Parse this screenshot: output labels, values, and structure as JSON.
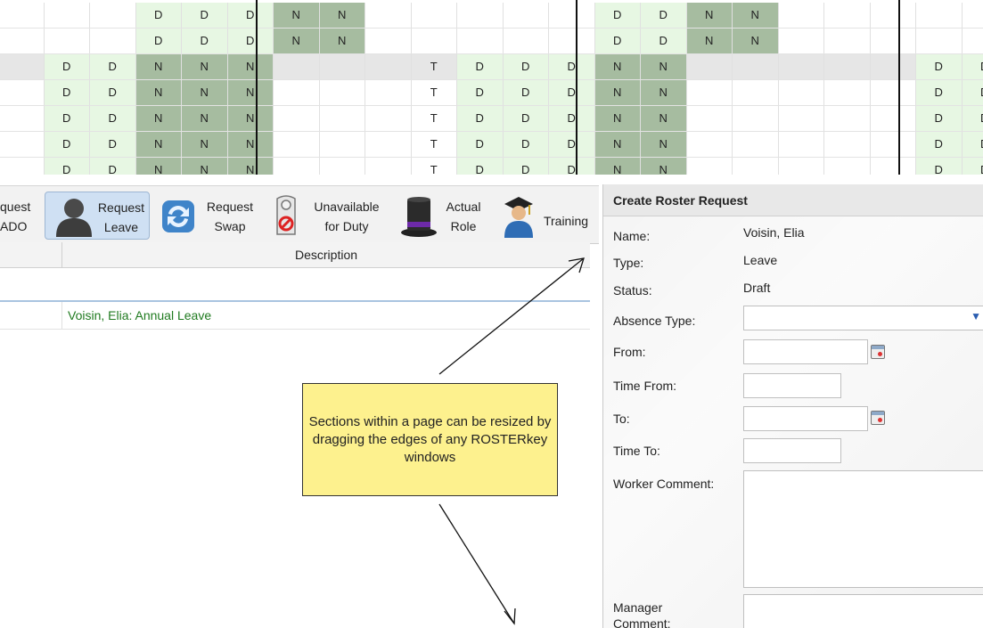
{
  "grid": {
    "rows": [
      [
        "",
        "",
        "",
        "D",
        "D",
        "D",
        "N",
        "N",
        "",
        "",
        "",
        "",
        "",
        "D",
        "D",
        "N",
        "N",
        "",
        "",
        "",
        "",
        ""
      ],
      [
        "",
        "",
        "",
        "D",
        "D",
        "D",
        "N",
        "N",
        "",
        "",
        "",
        "",
        "",
        "D",
        "D",
        "N",
        "N",
        "",
        "",
        "",
        "",
        ""
      ],
      [
        "",
        "D",
        "D",
        "N",
        "N",
        "N",
        "",
        "",
        "",
        "T",
        "D",
        "D",
        "D",
        "N",
        "N",
        "",
        "",
        "",
        "",
        "",
        "D",
        "D"
      ],
      [
        "",
        "D",
        "D",
        "N",
        "N",
        "N",
        "",
        "",
        "",
        "T",
        "D",
        "D",
        "D",
        "N",
        "N",
        "",
        "",
        "",
        "",
        "",
        "D",
        "D"
      ],
      [
        "",
        "D",
        "D",
        "N",
        "N",
        "N",
        "",
        "",
        "",
        "T",
        "D",
        "D",
        "D",
        "N",
        "N",
        "",
        "",
        "",
        "",
        "",
        "D",
        "D"
      ],
      [
        "",
        "D",
        "D",
        "N",
        "N",
        "N",
        "",
        "",
        "",
        "T",
        "D",
        "D",
        "D",
        "N",
        "N",
        "",
        "",
        "",
        "",
        "",
        "D",
        "D"
      ],
      [
        "",
        "D",
        "D",
        "N",
        "N",
        "N",
        "",
        "",
        "",
        "T",
        "D",
        "D",
        "D",
        "N",
        "N",
        "",
        "",
        "",
        "",
        "",
        "D",
        "D"
      ]
    ],
    "selected_row": 2,
    "colors": {
      "day": "#e7f7e3",
      "night": "#a6bca0"
    }
  },
  "toolbar": {
    "request_ado_line1": "quest",
    "request_ado_line2": "ADO",
    "request_leave_line1": "Request",
    "request_leave_line2": "Leave",
    "request_swap_line1": "Request",
    "request_swap_line2": "Swap",
    "unavailable_line1": "Unavailable",
    "unavailable_line2": "for Duty",
    "actual_role_line1": "Actual",
    "actual_role_line2": "Role",
    "training": "Training"
  },
  "table": {
    "description_header": "Description",
    "rows": [
      {
        "description": "Voisin, Elia: Annual Leave"
      }
    ]
  },
  "panel": {
    "title": "Create Roster Request",
    "name_label": "Name:",
    "name_value": "Voisin, Elia",
    "type_label": "Type:",
    "type_value": "Leave",
    "status_label": "Status:",
    "status_value": "Draft",
    "absence_type_label": "Absence Type:",
    "absence_type_value": "",
    "from_label": "From:",
    "from_value": "",
    "time_from_label": "Time From:",
    "time_from_value": "",
    "to_label": "To:",
    "to_value": "",
    "time_to_label": "Time To:",
    "time_to_value": "",
    "worker_comment_label": "Worker Comment:",
    "manager_comment_label_1": "Manager",
    "manager_comment_label_2": "Comment:"
  },
  "callout": {
    "text": "Sections within a page can be resized by dragging the edges of any ROSTERkey windows",
    "color": "#fdf18e"
  }
}
